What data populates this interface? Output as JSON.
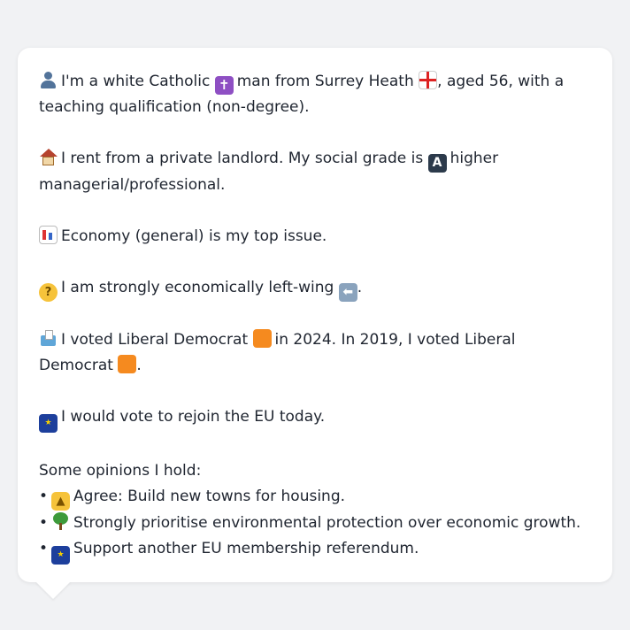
{
  "paragraphs": {
    "identity": {
      "text_1": "I'm a white Catholic",
      "text_2": "man from Surrey Heath",
      "text_3": ", aged 56, with a teaching qualification (non-degree).",
      "icons": [
        "person-icon",
        "latin-cross-icon",
        "england-flag-icon"
      ]
    },
    "housing": {
      "text_1": "I rent from a private landlord. My social grade is",
      "text_2": "higher managerial/professional.",
      "icons": [
        "house-icon",
        "letter-a-icon"
      ]
    },
    "issue": {
      "text": "Economy (general) is my top issue.",
      "icons": [
        "chart-icon"
      ]
    },
    "economics": {
      "text": "I am strongly economically left-wing",
      "trailing": ".",
      "icons": [
        "thinking-face-icon",
        "left-arrow-icon"
      ]
    },
    "voting": {
      "text_1": "I voted Liberal Democrat",
      "text_2": "in 2024. In 2019, I voted Liberal Democrat",
      "trailing": ".",
      "icons": [
        "ballot-box-icon",
        "orange-square-icon",
        "orange-square-icon"
      ]
    },
    "eu": {
      "text": "I would vote to rejoin the EU today.",
      "icons": [
        "eu-flag-icon"
      ]
    }
  },
  "opinions": {
    "heading": "Some opinions I hold:",
    "bullet": "•",
    "items": [
      {
        "text": "Agree: Build new towns for housing.",
        "icon": "thumbs-up-icon"
      },
      {
        "text": "Strongly prioritise environmental protection over economic growth.",
        "icon": "tree-icon"
      },
      {
        "text": "Support another EU membership referendum.",
        "icon": "eu-flag-icon"
      }
    ]
  },
  "glyphs": {
    "cross": "✝",
    "letter_a": "A",
    "thinking": "?",
    "left_arrow": "⬅",
    "eu_stars": "★",
    "thumb": "👍"
  },
  "colors": {
    "background": "#f1f2f4",
    "card": "#ffffff",
    "text": "#1f2530",
    "orange_square": "#f58a1f",
    "eu_blue": "#1d3f9c"
  }
}
